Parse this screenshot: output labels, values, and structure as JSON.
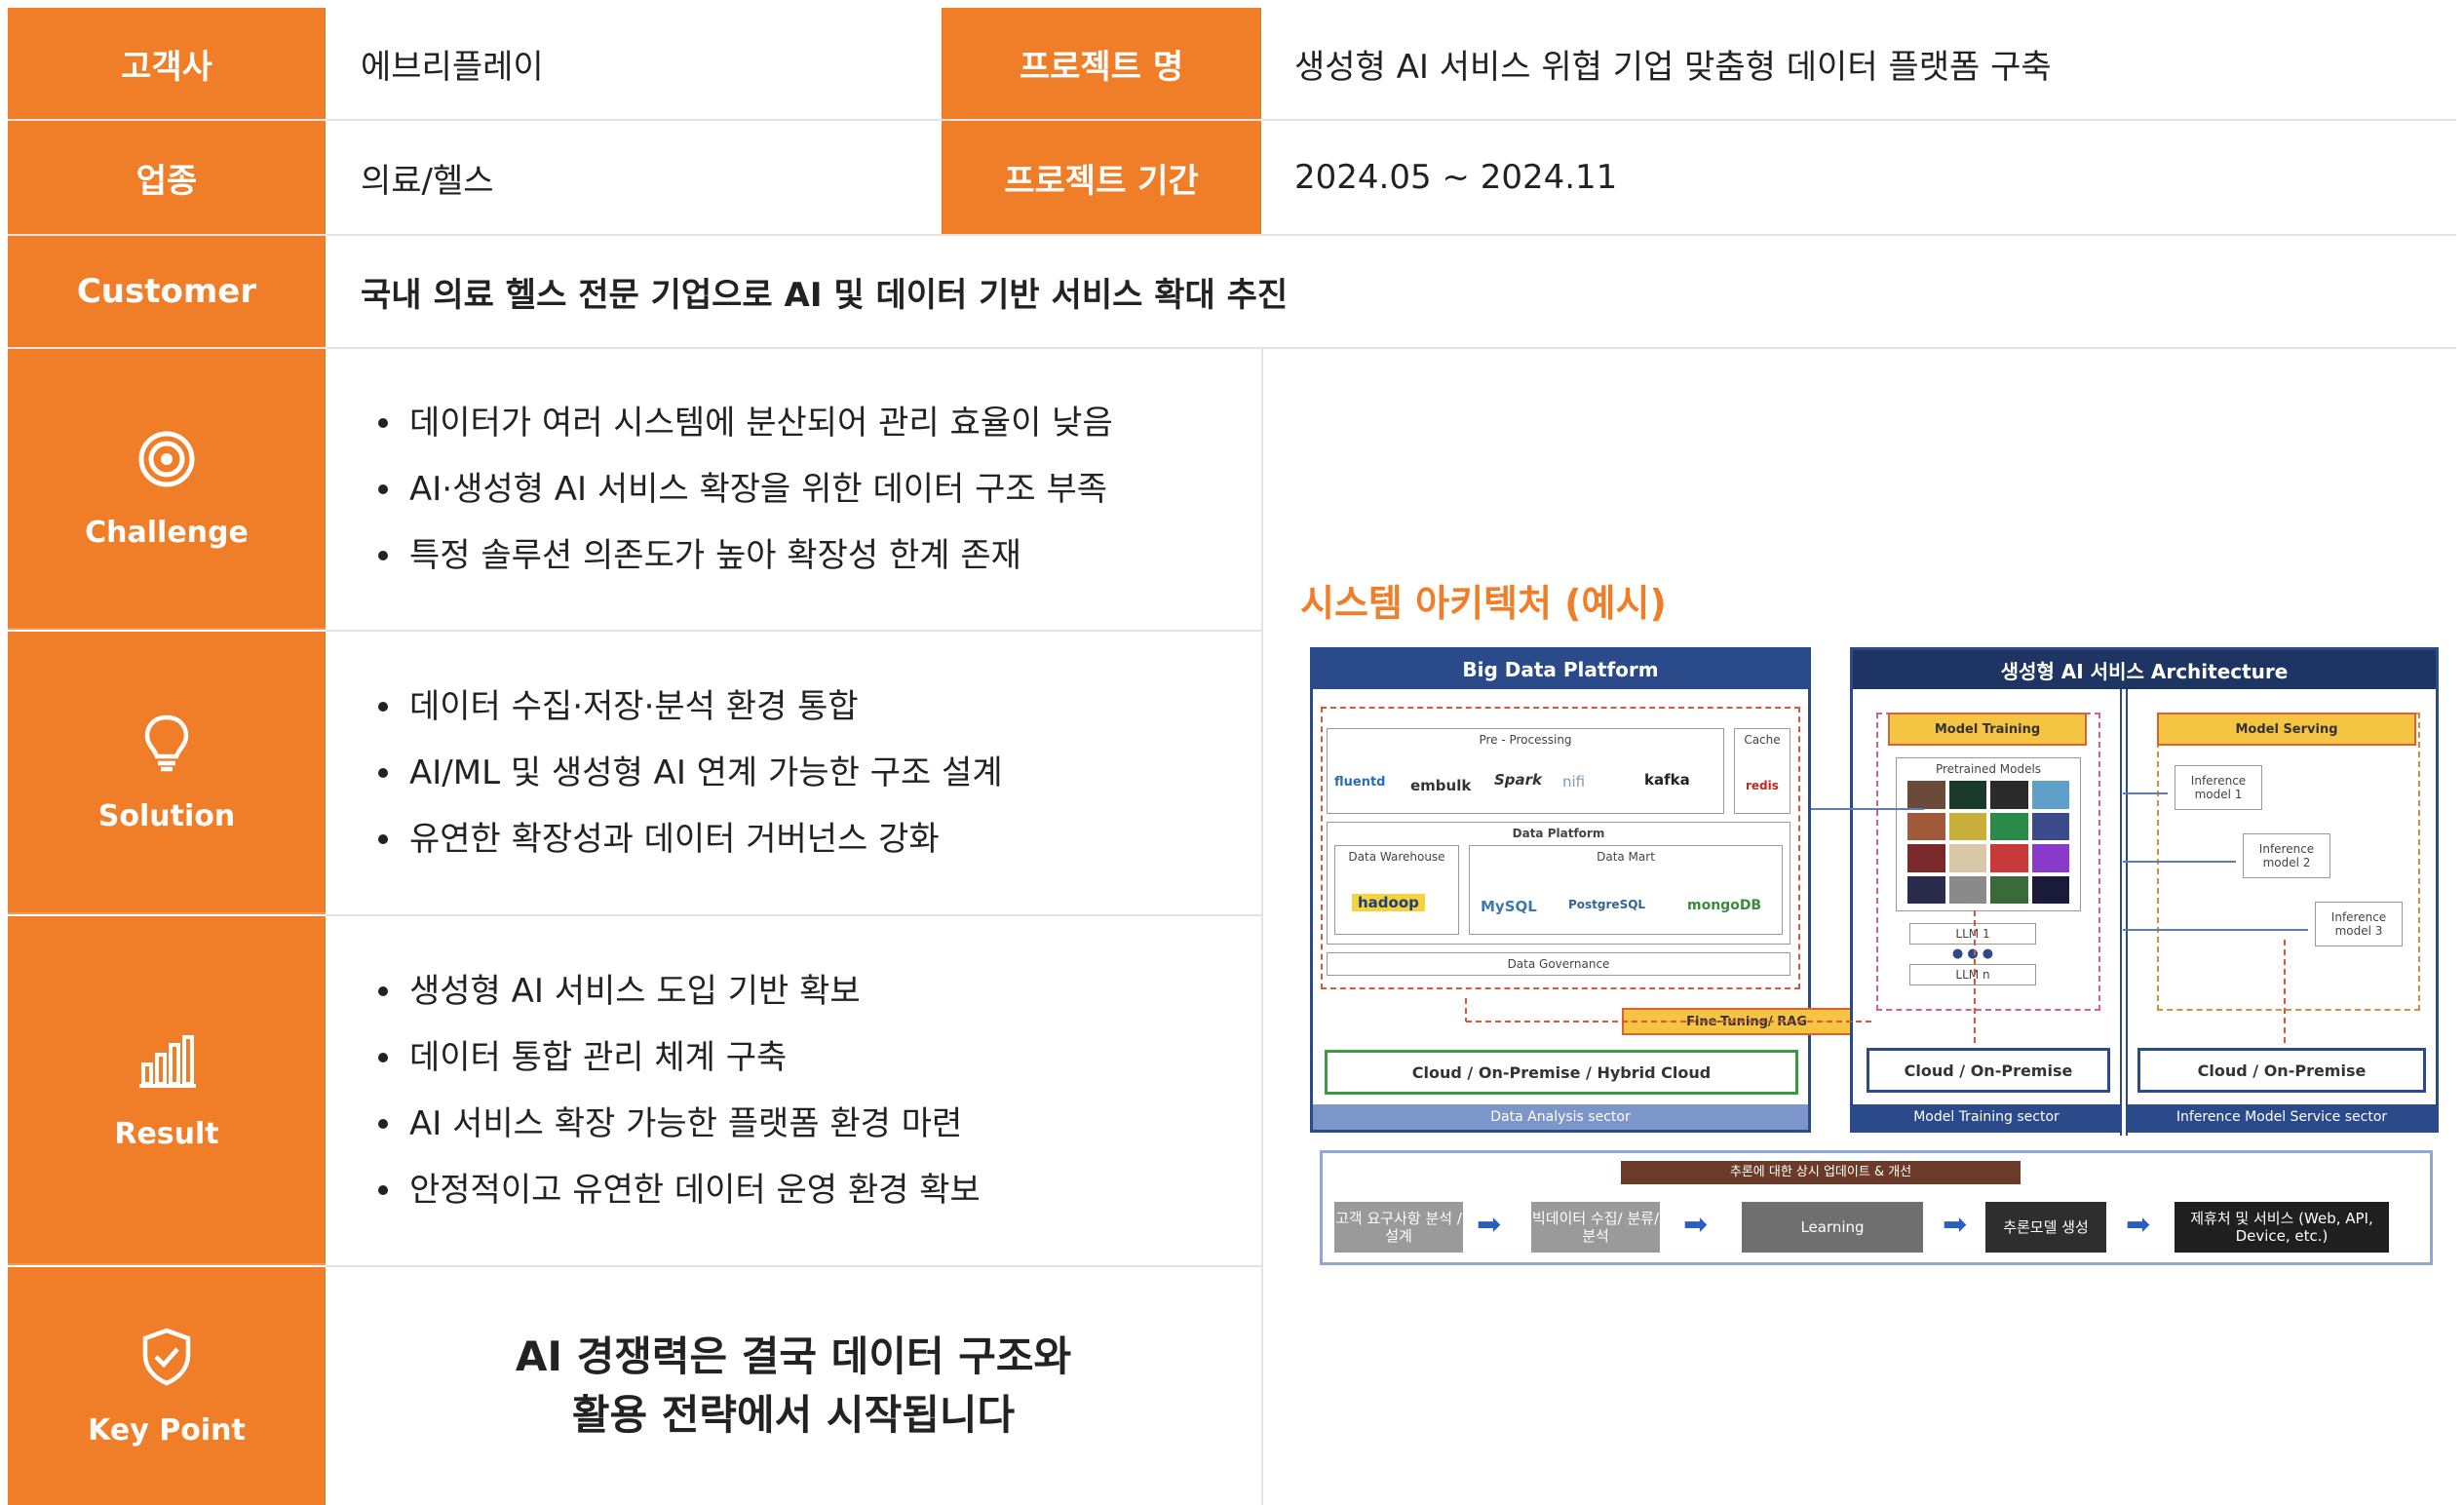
{
  "header": {
    "client_label": "고객사",
    "client_value": "에브리플레이",
    "project_label": "프로젝트 명",
    "project_value": "생성형 AI 서비스 위협 기업 맞춤형 데이터 플랫폼 구축",
    "industry_label": "업종",
    "industry_value": "의료/헬스",
    "period_label": "프로젝트 기간",
    "period_value": "2024.05 ~ 2024.11",
    "customer_label": "Customer",
    "customer_value": "국내 의료 헬스 전문 기업으로 AI 및 데이터 기반 서비스 확대 추진"
  },
  "sections": {
    "challenge": {
      "label": "Challenge",
      "icon": "target-icon",
      "bullets": [
        "데이터가 여러 시스템에 분산되어 관리 효율이 낮음",
        "AI·생성형 AI 서비스 확장을 위한 데이터 구조 부족",
        "특정 솔루션 의존도가 높아 확장성 한계 존재"
      ]
    },
    "solution": {
      "label": "Solution",
      "icon": "lightbulb-icon",
      "bullets": [
        "데이터 수집·저장·분석 환경 통합",
        "AI/ML 및 생성형 AI 연계 가능한 구조 설계",
        "유연한 확장성과 데이터 거버넌스 강화"
      ]
    },
    "result": {
      "label": "Result",
      "icon": "bar-chart-icon",
      "bullets": [
        "생성형 AI 서비스 도입 기반 확보",
        "데이터 통합 관리 체계 구축",
        "AI 서비스 확장 가능한 플랫폼 환경 마련",
        "안정적이고 유연한 데이터 운영 환경 확보"
      ]
    },
    "keypoint": {
      "label": "Key Point",
      "icon": "shield-check-icon",
      "line1": "AI 경쟁력은 결국 데이터 구조와",
      "line2": "활용 전략에서 시작됩니다"
    }
  },
  "architecture": {
    "title": "시스템 아키텍처 (예시)",
    "big_data": {
      "header": "Big Data Platform",
      "preprocessing": "Pre - Processing",
      "cache": "Cache",
      "logos_pre": [
        "fluentd",
        "embulk",
        "Spark",
        "nifi",
        "kafka"
      ],
      "redis": "redis",
      "data_platform": "Data Platform",
      "data_warehouse": "Data Warehouse",
      "hadoop": "hadoop",
      "data_mart": "Data Mart",
      "logos_mart": [
        "MySQL",
        "PostgreSQL",
        "mongoDB"
      ],
      "governance": "Data Governance",
      "cloud": "Cloud / On-Premise / Hybrid Cloud",
      "footer": "Data Analysis sector"
    },
    "fine_tuning": "Fine-Tuning/ RAG",
    "gen_ai": {
      "header": "생성형 AI 서비스 Architecture",
      "model_training": "Model Training",
      "pretrained": "Pretrained Models",
      "llm1": "LLM 1",
      "dots": "● ● ●",
      "llmn": "LLM n",
      "cloud_training": "Cloud / On-Premise",
      "footer_training": "Model Training sector",
      "model_serving": "Model Serving",
      "inference": [
        "Inference model 1",
        "Inference model 2",
        "Inference model 3"
      ],
      "cloud_serving": "Cloud / On-Premise",
      "footer_serving": "Inference Model Service sector"
    },
    "flow": {
      "feedback": "추론에 대한 상시 업데이트 & 개선",
      "steps": [
        "고객 요구사항 분석 / 설계",
        "빅데이터 수집/ 분류/분석",
        "Learning",
        "추론모델 생성",
        "제휴처 및 서비스 (Web, API, Device, etc.)"
      ]
    }
  },
  "colors": {
    "accent": "#f07d27",
    "navy": "#2b4a8a",
    "border": "#e3e3e3"
  }
}
